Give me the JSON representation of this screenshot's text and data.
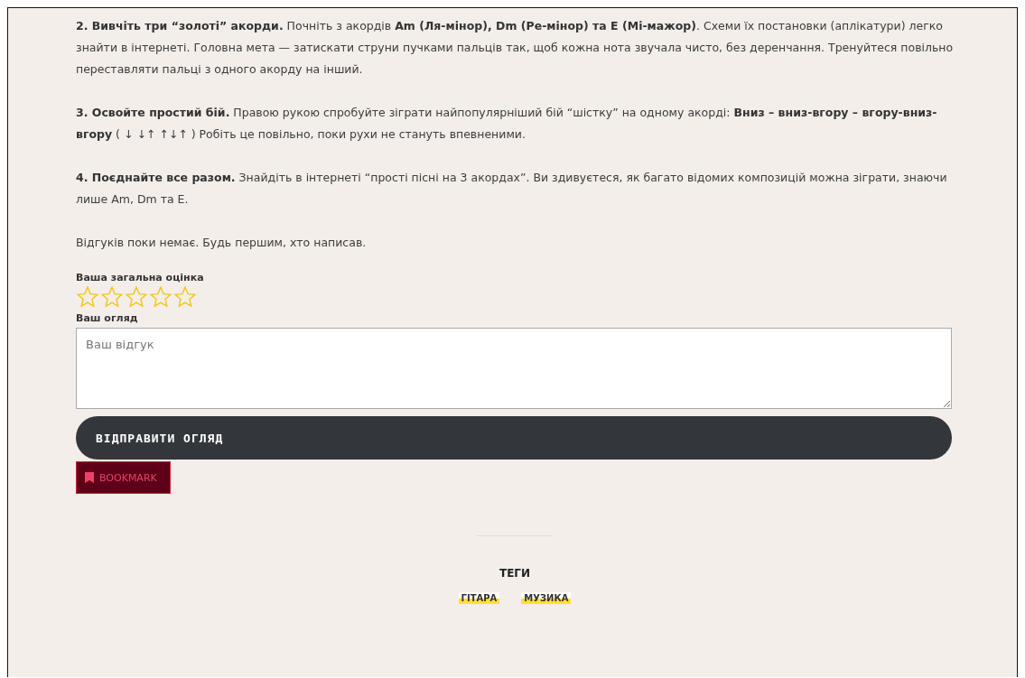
{
  "paragraphs": [
    "**2. Вивчіть три “золоті” акорди.** Почніть з акордів **Am (Ля-мінор), Dm (Ре-мінор) та E (Мі-мажор)**. Схеми їх постановки (аплікатури) легко знайти в інтернеті. Головна мета — затискати струни пучками пальців так, щоб кожна нота звучала чисто, без деренчання. Тренуйтеся повільно переставляти пальці з одного акорду на інший.",
    "**3. Освойте простий бій.** Правою рукою спробуйте зіграти найпопулярніший бій “шістку” на одному акорді: **Вниз – вниз-вгору – вгору-вниз-вгору** ( ↓ ↓↑ ↑↓↑ ) Робіть це повільно, поки рухи не стануть впевненими.",
    "**4. Поєднайте все разом.** Знайдіть в інтернеті “прості пісні на 3 акордах”. Ви здивуєтеся, як багато відомих композицій можна зіграти, знаючи лише Am, Dm та E."
  ],
  "no_reviews": "Відгуків поки немає. Будь першим, хто написав.",
  "rating": {
    "label": "Ваша загальна оцінка",
    "stars": 0
  },
  "review": {
    "label": "Ваш огляд",
    "placeholder": "Ваш відгук"
  },
  "submit_button": "ВІДПРАВИТИ ОГЛЯД",
  "bookmark_button": "BOOKMARK",
  "tags": {
    "title": "ТЕГИ",
    "items": [
      "ГІТАРА",
      "МУЗИКА"
    ]
  }
}
